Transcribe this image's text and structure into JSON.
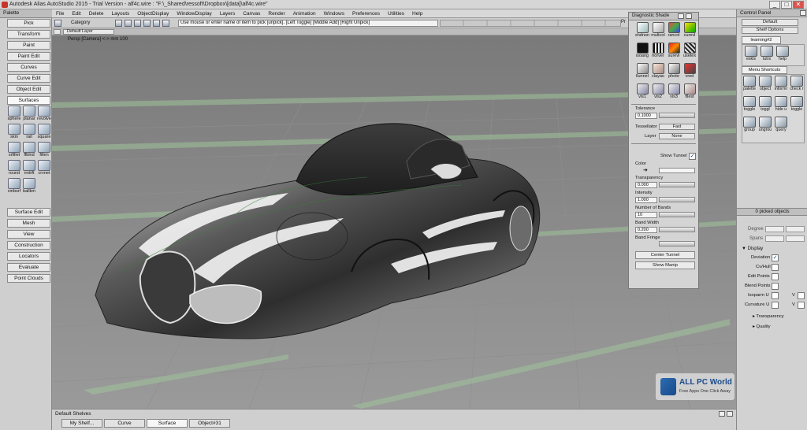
{
  "window": {
    "title": "Autodesk Alias AutoStudio 2015 - Trial Version - alf4c.wire : \"F:\\_Shared\\ressoft\\Dropbox\\[data]\\alf4c.wire\"",
    "btn_min": "_",
    "btn_max": "□",
    "btn_close": "✕"
  },
  "palette": {
    "header": "Palette",
    "buttons": [
      "Pick",
      "Transform",
      "Paint",
      "Paint Edit",
      "Curves",
      "Curve Edit",
      "Object Edit",
      "Surfaces"
    ],
    "tools": [
      "sphere",
      "planar",
      "revolve",
      "skin",
      "rail",
      "square",
      "srfillet",
      "ffblnd",
      "fillen",
      "round",
      "rndrft",
      "crvnet",
      "cmbsrf",
      "ballkm"
    ],
    "buttons_lower": [
      "Surface Edit",
      "Mesh",
      "View",
      "Construction",
      "Locators",
      "Evaluate",
      "Point Clouds"
    ]
  },
  "menubar": [
    "File",
    "Edit",
    "Delete",
    "Layouts",
    "ObjectDisplay",
    "WindowDisplay",
    "Layers",
    "Canvas",
    "Render",
    "Animation",
    "Windows",
    "Preferences",
    "Utilities",
    "Help"
  ],
  "toolbar": {
    "category": "Category",
    "hint": "Use mouse or enter name of item to pick [unpick]. [Left Toggle] [Middle Add] [Right Unpick]",
    "layer": "Default Layer",
    "right_label": "Pr"
  },
  "viewport": {
    "label": "Persp [Camera] <-> mm  100"
  },
  "diagnostic": {
    "title": "Diagnostic Shade",
    "icons": [
      "shdnon",
      "multcol",
      "rancol",
      "curevl",
      "isoang",
      "horver",
      "surevl",
      "usetex",
      "llunnel",
      "clayao",
      "phote",
      "vred",
      "vis1",
      "vis2",
      "vis3",
      "filest"
    ],
    "tolerance_label": "Tolerance",
    "tolerance_value": "0.1000",
    "tessellator_label": "Tessellator",
    "tessellator_value": "Fast",
    "layer_label": "Layer",
    "layer_value": "None",
    "show_tunnel_label": "Show Tunnel",
    "color_label": "Color",
    "transparency_label": "Transparency",
    "transparency_value": "0.000",
    "intensity_label": "Intensity",
    "intensity_value": "1.000",
    "bands_label": "Number of Bands",
    "bands_value": "10",
    "bandwidth_label": "Band Width",
    "bandwidth_value": "0.200",
    "bandfringe_label": "Band Fringe",
    "center_tunnel": "Center Tunnel",
    "show_manip": "Show Manip"
  },
  "control": {
    "title": "Control Panel",
    "default": "Default",
    "shelf_options": "Shelf Options",
    "learning_tab": "learning#2",
    "icons_top": [
      "eskls",
      "tutrs",
      "help"
    ],
    "menu_tab": "Menu Shortcuts",
    "icons_menu": [
      "palette",
      "object",
      "informr",
      "check r",
      "toggle",
      "toggl",
      "hide u",
      "toggle",
      "group",
      "ungrou",
      "query"
    ],
    "picked": "0 picked objects",
    "degree_label": "Degree",
    "spans_label": "Spans",
    "display_label": "Display",
    "display_items": [
      "Deviation",
      "Cv/Hull",
      "Edit Points",
      "Blend Points",
      "Isoparm U",
      "Curvature U",
      "Transparency",
      "Quality"
    ],
    "v_label": "V"
  },
  "shelves": {
    "title": "Default Shelves",
    "tabs": [
      "My Shelf...",
      "Curve",
      "Surface",
      "Object#31"
    ]
  },
  "watermark": {
    "brand": "ALL PC World",
    "tagline": "Free Apps One Click Away"
  }
}
